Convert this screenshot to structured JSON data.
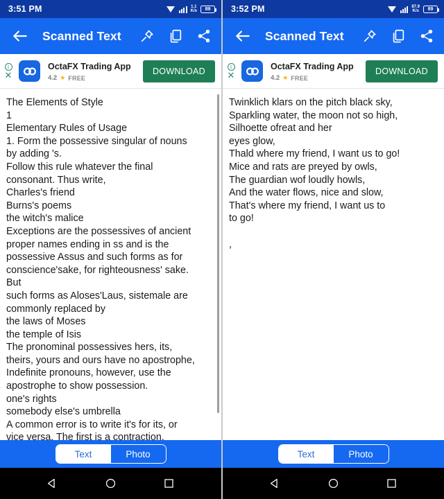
{
  "app": {
    "title": "Scanned Text",
    "accent_blue": "#1568f0",
    "statusbar_blue": "#0d39a0",
    "ad_button_green": "#1e7f55"
  },
  "panels": [
    {
      "id": "left",
      "status": {
        "time": "3:51 PM",
        "net_rate_value": "1.1",
        "net_rate_unit": "K/s",
        "battery": "89",
        "wifi_icon": "wifi-icon",
        "signal_icon": "signal-bars-icon"
      },
      "toolbar": {
        "back_icon": "back-arrow-icon",
        "title": "Scanned Text",
        "pin_icon": "pin-icon",
        "copy_icon": "copy-icon",
        "share_icon": "share-icon"
      },
      "ad": {
        "info_glyph": "i",
        "close_glyph": "✕",
        "logo_text": "OC",
        "title": "OctaFX Trading App",
        "rating": "4.2",
        "star": "★",
        "price_label": "FREE",
        "button_label": "DOWNLOAD"
      },
      "content": "The Elements of Style\n1\nElementary Rules of Usage\n1. Form the possessive singular of nouns\nby adding 's.\nFollow this rule whatever the final\nconsonant. Thus write,\nCharles's friend\nBurns's poems\nthe witch's malice\nExceptions are the possessives of ancient\nproper names ending in ss and is the\npossessive Assus and such forms as for\nconscience'sake, for righteousness' sake.\nBut\nsuch forms as Aloses'Laus, sistemale are\ncommonly replaced by\nthe laws of Moses\nthe temple of Isis\nThe pronominal possessives hers, its,\ntheirs, yours and ours have no apostrophe,\nIndefinite pronouns, however, use the\napostrophe to show possession.\none's rights\nsomebody else's umbrella\nA common error is to write it's for its, or\nvice versa. The first is a contraction,",
      "scrollbar": {
        "visible": true
      },
      "tabs": {
        "text_label": "Text",
        "photo_label": "Photo",
        "selected": "Text"
      },
      "nav": {
        "back_icon": "nav-back-triangle-icon",
        "home_icon": "nav-home-circle-icon",
        "recents_icon": "nav-recents-square-icon"
      }
    },
    {
      "id": "right",
      "status": {
        "time": "3:52 PM",
        "net_rate_value": "87.9",
        "net_rate_unit": "K/s",
        "battery": "89",
        "wifi_icon": "wifi-icon",
        "signal_icon": "signal-bars-icon"
      },
      "toolbar": {
        "back_icon": "back-arrow-icon",
        "title": "Scanned Text",
        "pin_icon": "pin-icon",
        "copy_icon": "copy-icon",
        "share_icon": "share-icon"
      },
      "ad": {
        "info_glyph": "i",
        "close_glyph": "✕",
        "logo_text": "OC",
        "title": "OctaFX Trading App",
        "rating": "4.2",
        "star": "★",
        "price_label": "FREE",
        "button_label": "DOWNLOAD"
      },
      "content": "Twinklich klars on the pitch black sky,\nSparkling water, the moon not so high,\nSilhoette ofreat and her\neyes glow,\nThald where my friend, I want us to go!\nMice and rats are preyed by owls,\nThe guardian wof loudly howls,\nAnd the water flows, nice and slow,\nThat's where my friend, I want us to\nto go!\n\n,",
      "scrollbar": {
        "visible": false
      },
      "tabs": {
        "text_label": "Text",
        "photo_label": "Photo",
        "selected": "Text"
      },
      "nav": {
        "back_icon": "nav-back-triangle-icon",
        "home_icon": "nav-home-circle-icon",
        "recents_icon": "nav-recents-square-icon"
      }
    }
  ]
}
